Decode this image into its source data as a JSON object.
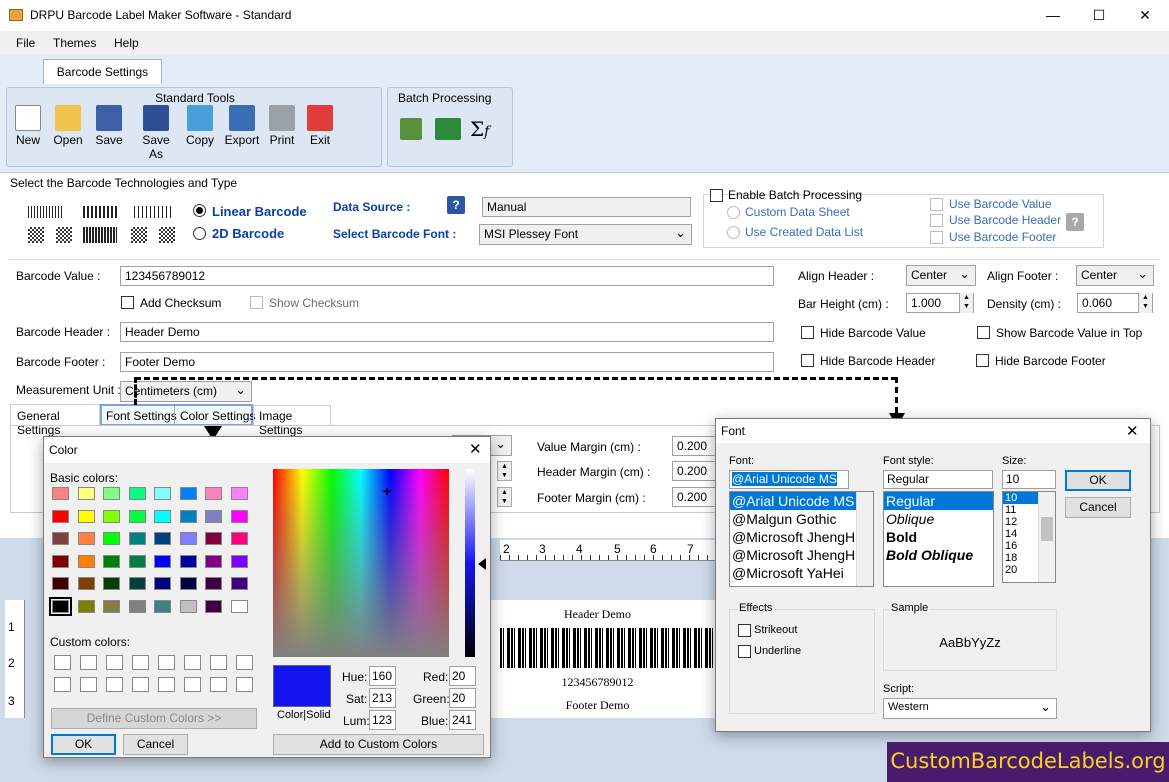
{
  "app": {
    "title": "DRPU Barcode Label Maker Software - Standard",
    "min": "—",
    "max": "☐",
    "close": "✕"
  },
  "menu": [
    "File",
    "Themes",
    "Help"
  ],
  "ribbon": {
    "tab": "Barcode Settings",
    "standard_tools": "Standard Tools",
    "batch_processing": "Batch Processing",
    "tools": [
      {
        "label": "New",
        "icon": "new-file-icon"
      },
      {
        "label": "Open",
        "icon": "open-folder-icon"
      },
      {
        "label": "Save",
        "icon": "save-icon"
      },
      {
        "label": "Save As",
        "icon": "save-as-icon"
      },
      {
        "label": "Copy",
        "icon": "copy-icon"
      },
      {
        "label": "Export",
        "icon": "export-icon"
      },
      {
        "label": "Print",
        "icon": "printer-icon"
      },
      {
        "label": "Exit",
        "icon": "exit-icon"
      }
    ],
    "batch_tools": [
      "edit-batch-icon",
      "excel-import-icon",
      "formula-icon"
    ]
  },
  "tech": {
    "heading": "Select the Barcode Technologies and Type",
    "linear": "Linear Barcode",
    "twod": "2D Barcode",
    "data_source_label": "Data Source :",
    "data_source_value": "Manual",
    "font_label": "Select Barcode Font :",
    "font_value": "MSI Plessey Font",
    "help": "?"
  },
  "batch": {
    "enable": "Enable Batch Processing",
    "custom": "Custom Data Sheet",
    "created": "Use Created Data List",
    "use_value": "Use Barcode Value",
    "use_header": "Use Barcode Header",
    "use_footer": "Use Barcode Footer"
  },
  "fields": {
    "value_label": "Barcode Value :",
    "value": "123456789012",
    "add_checksum": "Add Checksum",
    "show_checksum": "Show Checksum",
    "header_label": "Barcode Header :",
    "header": "Header Demo",
    "footer_label": "Barcode Footer :",
    "footer": "Footer Demo",
    "unit_label": "Measurement Unit :",
    "unit": "Centimeters (cm)"
  },
  "right": {
    "align_header_label": "Align Header :",
    "align_header": "Center",
    "align_footer_label": "Align Footer :",
    "align_footer": "Center",
    "bar_height_label": "Bar Height (cm) :",
    "bar_height": "1.000",
    "density_label": "Density (cm) :",
    "density": "0.060",
    "hide_value": "Hide Barcode Value",
    "show_top": "Show Barcode Value in Top",
    "hide_header": "Hide Barcode Header",
    "hide_footer": "Hide Barcode Footer"
  },
  "settings_tabs": [
    "General Settings",
    "Font Settings",
    "Color Settings",
    "Image Settings"
  ],
  "margins": {
    "value_label": "Value Margin (cm) :",
    "value": "0.200",
    "header_label": "Header Margin (cm) :",
    "header": "0.200",
    "footer_label": "Footer Margin (cm) :",
    "footer": "0.200"
  },
  "preview": {
    "header": "Header Demo",
    "value": "123456789012",
    "footer": "Footer Demo",
    "ruler": [
      "2",
      "3",
      "4",
      "5",
      "6",
      "7"
    ],
    "vruler": [
      "1",
      "2",
      "3"
    ]
  },
  "color_dialog": {
    "title": "Color",
    "basic": "Basic colors:",
    "custom": "Custom colors:",
    "define": "Define Custom Colors >>",
    "ok": "OK",
    "cancel": "Cancel",
    "color_solid": "Color|Solid",
    "hue_label": "Hue:",
    "hue": "160",
    "sat_label": "Sat:",
    "sat": "213",
    "lum_label": "Lum:",
    "lum": "123",
    "red_label": "Red:",
    "red": "20",
    "green_label": "Green:",
    "green": "20",
    "blue_label": "Blue:",
    "blue": "241",
    "add": "Add to Custom Colors",
    "selected_color": "#1414f1",
    "basic_colors": [
      "#ff8080",
      "#ffff80",
      "#80ff80",
      "#00ff80",
      "#80ffff",
      "#0080ff",
      "#ff80c0",
      "#ff80ff",
      "#ff0000",
      "#ffff00",
      "#80ff00",
      "#00ff40",
      "#00ffff",
      "#0080c0",
      "#8080c0",
      "#ff00ff",
      "#804040",
      "#ff8040",
      "#00ff00",
      "#008080",
      "#004080",
      "#8080ff",
      "#800040",
      "#ff0080",
      "#800000",
      "#ff8000",
      "#008000",
      "#008040",
      "#0000ff",
      "#0000a0",
      "#800080",
      "#8000ff",
      "#400000",
      "#804000",
      "#004000",
      "#004040",
      "#000080",
      "#000040",
      "#400040",
      "#400080",
      "#000000",
      "#808000",
      "#808040",
      "#808080",
      "#408080",
      "#c0c0c0",
      "#400040",
      "#ffffff"
    ]
  },
  "font_dialog": {
    "title": "Font",
    "font_label": "Font:",
    "font_value": "@Arial Unicode MS",
    "fonts": [
      "@Arial Unicode MS",
      "@Malgun Gothic",
      "@Microsoft JhengH",
      "@Microsoft JhengH",
      "@Microsoft YaHei"
    ],
    "style_label": "Font style:",
    "style_value": "Regular",
    "styles": [
      "Regular",
      "Oblique",
      "Bold",
      "Bold Oblique"
    ],
    "size_label": "Size:",
    "size_value": "10",
    "sizes": [
      "10",
      "11",
      "12",
      "14",
      "16",
      "18",
      "20"
    ],
    "ok": "OK",
    "cancel": "Cancel",
    "effects": "Effects",
    "strikeout": "Strikeout",
    "underline": "Underline",
    "sample_label": "Sample",
    "sample": "AaBbYyZz",
    "script_label": "Script:",
    "script": "Western"
  },
  "watermark": "CustomBarcodeLabels.org"
}
